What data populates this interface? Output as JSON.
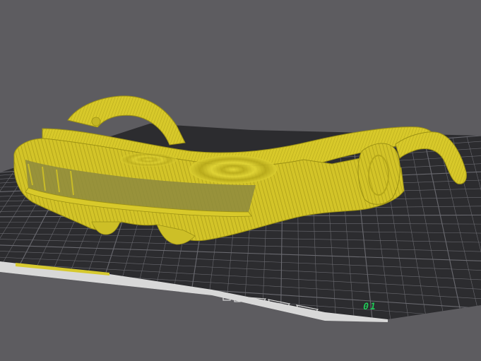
{
  "viewport": {
    "background_color": "#5d5c60"
  },
  "build_plate": {
    "surface_color": "#2c2c2f",
    "grid_color": "#6a6a70",
    "edge_label_color": "#d8d8d8",
    "plate_number": "01",
    "plate_number_color": "#23c95a"
  },
  "model": {
    "name": "sliced-visor-glasses",
    "color": "#d8c92a",
    "highlight_color": "#eadf3a",
    "shadow_color": "#9c9114",
    "lens_color": "#8d8a3e"
  }
}
